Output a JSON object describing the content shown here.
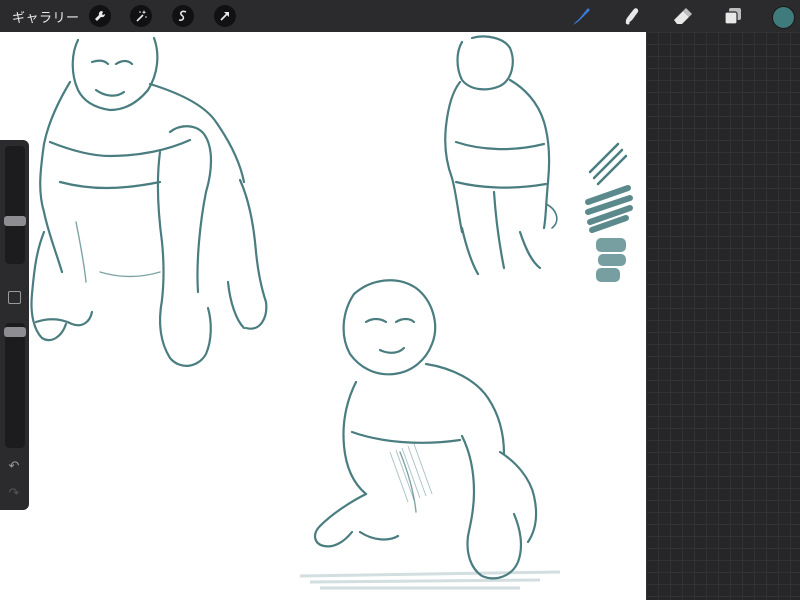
{
  "topbar": {
    "gallery_label": "ギャラリー",
    "actions": [
      "wrench-icon",
      "magic-wand-icon",
      "selection-s-icon",
      "transform-arrow-icon"
    ],
    "tools": [
      "brush-icon",
      "smudge-icon",
      "eraser-icon",
      "layers-icon"
    ],
    "active_tool": "brush-icon",
    "current_color": "#3f7a7c"
  },
  "sidebar": {
    "brush_size_level": 0.3,
    "opacity_level": 0.02,
    "undo_icon": "↶",
    "redo_icon": "↷"
  },
  "canvas": {
    "stroke_color": "#4a7d80",
    "background": "#ffffff"
  }
}
